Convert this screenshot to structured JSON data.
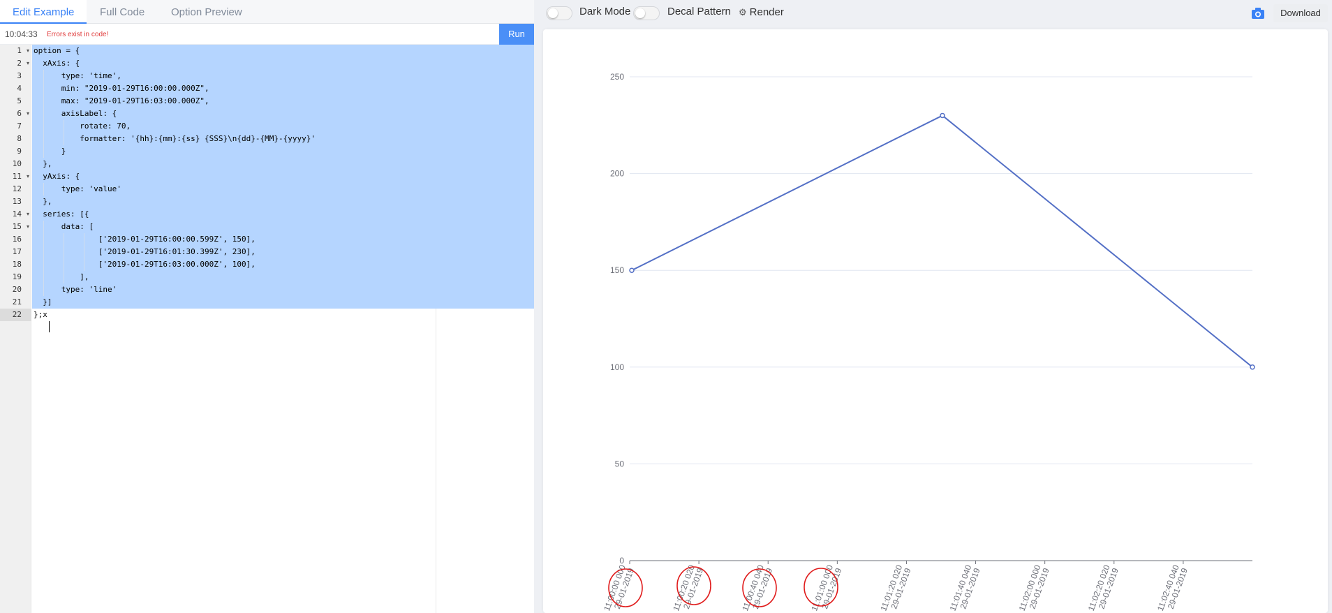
{
  "editor_tabs": [
    "Edit Example",
    "Full Code",
    "Option Preview"
  ],
  "status": {
    "time": "10:04:33",
    "error": "Errors exist in code!",
    "run_label": "Run"
  },
  "code_lines": [
    "option = {",
    "  xAxis: {",
    "      type: 'time',",
    "      min: \"2019-01-29T16:00:00.000Z\",",
    "      max: \"2019-01-29T16:03:00.000Z\",",
    "      axisLabel: {",
    "          rotate: 70,",
    "          formatter: '{hh}:{mm}:{ss} {SSS}\\n{dd}-{MM}-{yyyy}'",
    "      }",
    "  },",
    "  yAxis: {",
    "      type: 'value'",
    "  },",
    "  series: [{",
    "      data: [",
    "              ['2019-01-29T16:00:00.599Z', 150],",
    "              ['2019-01-29T16:01:30.399Z', 230],",
    "              ['2019-01-29T16:03:00.000Z', 100],",
    "          ],",
    "      type: 'line'",
    "  }]",
    "};x"
  ],
  "toolbar": {
    "dark_mode_label": "Dark Mode",
    "decal_label": "Decal Pattern",
    "render_label": "Render",
    "download_label": "Download"
  },
  "chart_data": {
    "type": "line",
    "x_type": "time",
    "x_min": "2019-01-29T16:00:00.000Z",
    "x_max": "2019-01-29T16:03:00.000Z",
    "ylim": [
      0,
      250
    ],
    "yticks": [
      0,
      50,
      100,
      150,
      200,
      250
    ],
    "xtick_labels": [
      {
        "t": "11:00:00 000",
        "d": "29-01-2019"
      },
      {
        "t": "11:00:20 020",
        "d": "29-01-2019"
      },
      {
        "t": "11:00:40 040",
        "d": "29-01-2019"
      },
      {
        "t": "11:01:00 000",
        "d": "29-01-2019"
      },
      {
        "t": "11:01:20 020",
        "d": "29-01-2019"
      },
      {
        "t": "11:01:40 040",
        "d": "29-01-2019"
      },
      {
        "t": "11:02:00 000",
        "d": "29-01-2019"
      },
      {
        "t": "11:02:20 020",
        "d": "29-01-2019"
      },
      {
        "t": "11:02:40 040",
        "d": "29-01-2019"
      }
    ],
    "series": [
      {
        "data": [
          [
            "2019-01-29T16:00:00.599Z",
            150
          ],
          [
            "2019-01-29T16:01:30.399Z",
            230
          ],
          [
            "2019-01-29T16:03:00.000Z",
            100
          ]
        ]
      }
    ],
    "grid": true,
    "line_color": "#5470c6"
  }
}
